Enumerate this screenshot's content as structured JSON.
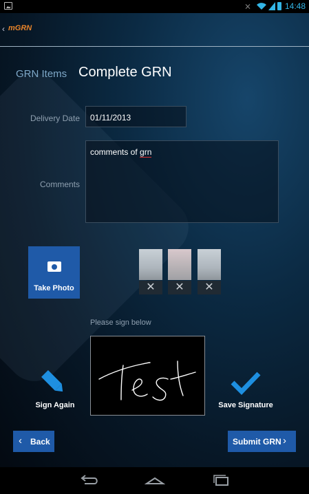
{
  "status_bar": {
    "time": "14:48",
    "icons": [
      "gallery-icon",
      "mute-icon",
      "wifi-icon",
      "signal-icon",
      "battery-icon"
    ]
  },
  "action_bar": {
    "back_glyph": "‹",
    "app_logo": "mGRN"
  },
  "tabs": {
    "grn_items": "GRN Items",
    "complete_grn": "Complete GRN"
  },
  "form": {
    "delivery_date_label": "Delivery Date",
    "delivery_date_value": "01/11/2013",
    "comments_label": "Comments",
    "comments_prefix": "comments of ",
    "comments_flagged_word": "grn"
  },
  "photos": {
    "take_photo_label": "Take Photo",
    "thumbnail_delete_glyph": "✕"
  },
  "signature": {
    "prompt": "Please sign below",
    "sign_again_label": "Sign Again",
    "save_signature_label": "Save Signature"
  },
  "footer": {
    "back_label": "Back",
    "submit_label": "Submit GRN",
    "chev_left": "‹",
    "chev_right": "›"
  },
  "colors": {
    "accent_blue": "#1f5aa8",
    "status_blue": "#33b5e5",
    "logo_orange": "#e8842a",
    "icon_blue": "#1e8fe0"
  },
  "system_nav": [
    "back-nav-icon",
    "home-nav-icon",
    "recent-apps-icon"
  ]
}
